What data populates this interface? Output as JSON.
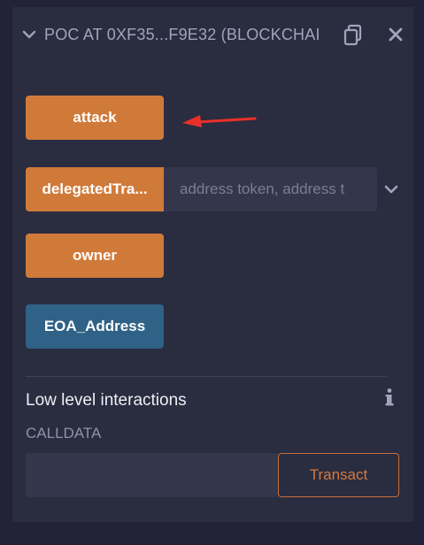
{
  "header": {
    "title": "POC AT 0XF35...F9E32 (BLOCKCHAI",
    "copy_icon": "copy-icon",
    "close_icon": "close-icon"
  },
  "functions": {
    "attack_label": "attack",
    "delegated_label": "delegatedTra...",
    "delegated_placeholder": "address token, address t",
    "owner_label": "owner",
    "eoa_label": "EOA_Address"
  },
  "low_level": {
    "title": "Low level interactions",
    "calldata_label": "CALLDATA",
    "calldata_value": "",
    "transact_label": "Transact"
  },
  "colors": {
    "panel_bg": "#2a2c3f",
    "orange_button": "#d07a3a",
    "blue_button": "#2f6286",
    "annotation_arrow": "#e8302a"
  }
}
